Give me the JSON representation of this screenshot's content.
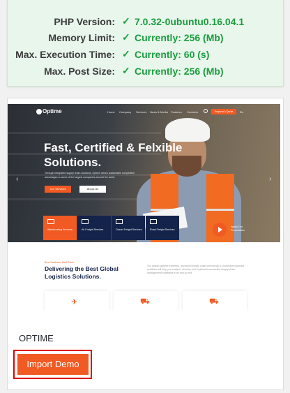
{
  "system_info": {
    "rows": [
      {
        "label": "PHP Version:",
        "value": "7.0.32-0ubuntu0.16.04.1"
      },
      {
        "label": "Memory Limit:",
        "value": "Currently: 256 (Mb)"
      },
      {
        "label": "Max. Execution Time:",
        "value": "Currently: 60 (s)"
      },
      {
        "label": "Max. Post Size:",
        "value": "Currently: 256 (Mb)"
      }
    ],
    "check_glyph": "✓",
    "status_color": "#1b9d3e"
  },
  "demo": {
    "name": "OPTIME",
    "import_label": "Import Demo",
    "accent": "#f15a22",
    "preview": {
      "logo": "Optime",
      "nav": [
        "Home",
        "Company",
        "Services",
        "News & Media",
        "Features",
        "Contacts"
      ],
      "nav_button": "Request A Quote",
      "nav_lang": "En",
      "hero_title": "Fast, Certified & Felxible Solutions.",
      "hero_text": "Through integrated supply chain solutions, Optime drives sustainable competitive advantages to some of the largest companies around the world.",
      "btn_primary": "Our Services",
      "btn_secondary": "About Us",
      "tiles": [
        "Warehousing Services",
        "Air Freight Services",
        "Ocean Freight Services",
        "Road Freight Services"
      ],
      "watch": "Watch Our Presentation",
      "tag": "Best Solutions, Best Price!",
      "heading": "Delivering the Best Global Logistics Solutions.",
      "paragraph": "Our global logistics expertise, advanced supply chain technology & customized logistics solutions will help you analyze, develop and implement successful supply chain management strategies from end-to-end."
    }
  }
}
